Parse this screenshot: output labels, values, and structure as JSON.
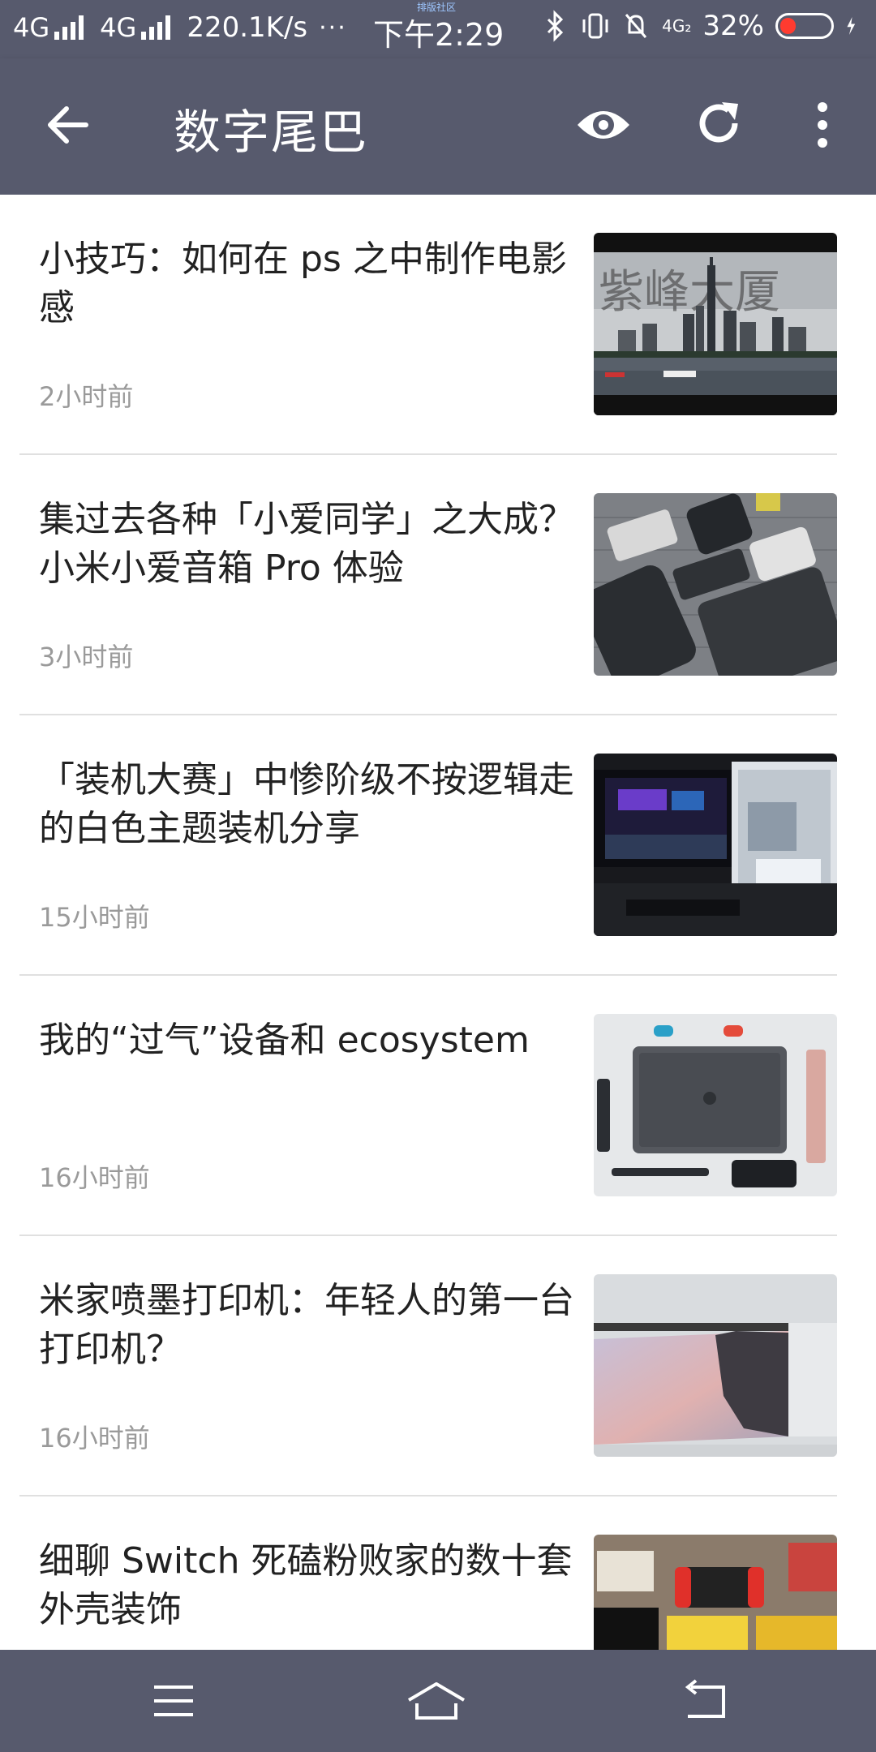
{
  "status_bar": {
    "network1": "4G",
    "network2": "4G",
    "speed": "220.1K/s",
    "more": "···",
    "time": "下午2:29",
    "network3": "4G₂",
    "battery": "32%",
    "watermark": "排版社区",
    "battery_level": 0.32
  },
  "app_bar": {
    "title": "数字尾巴",
    "back_icon": "arrow-left-icon",
    "view_icon": "eye-icon",
    "refresh_icon": "refresh-icon",
    "menu_icon": "more-vertical-icon"
  },
  "feed": {
    "items": [
      {
        "title": "小技巧：如何在 ps 之中制作电影感",
        "time": "2小时前"
      },
      {
        "title": "集过去各种「小爱同学」之大成？小米小爱音箱 Pro 体验",
        "time": "3小时前"
      },
      {
        "title": "「装机大赛」中惨阶级不按逻辑走的白色主题装机分享",
        "time": "15小时前"
      },
      {
        "title": "我的“过气”设备和 ecosystem",
        "time": "16小时前"
      },
      {
        "title": "米家喷墨打印机：年轻人的第一台打印机？",
        "time": "16小时前"
      },
      {
        "title": "细聊 Switch 死磕粉败家的数十套外壳装饰",
        "time": ""
      }
    ]
  },
  "nav_bar": {
    "menu_icon": "menu-icon",
    "home_icon": "home-icon",
    "back_icon": "back-icon"
  },
  "colors": {
    "bar": "#575a6d",
    "title_text": "#222222",
    "time_text": "#9a9a9a",
    "divider": "#e0e0e0"
  }
}
